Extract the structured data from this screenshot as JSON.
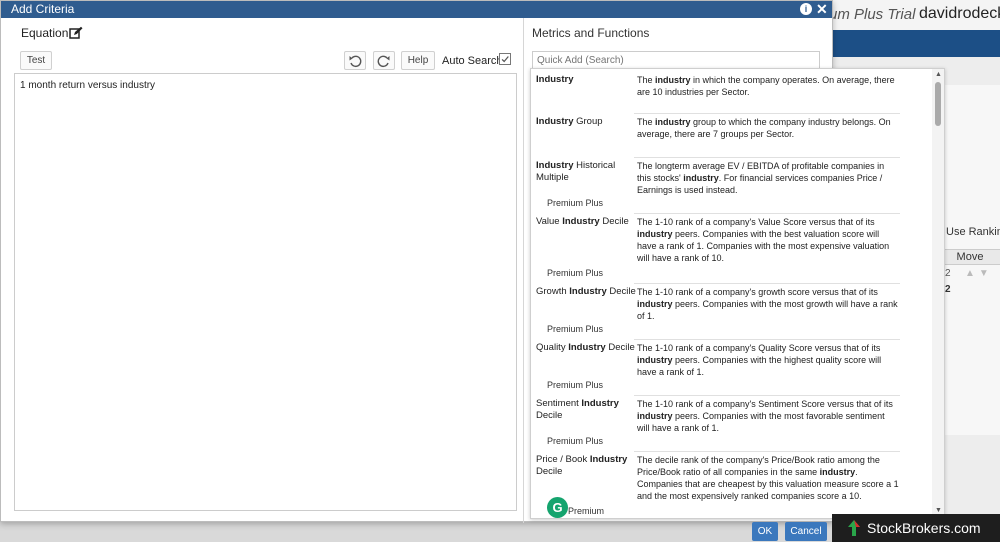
{
  "background": {
    "trial_text": "um Plus Trial",
    "username": "davidrodeck",
    "use_ranking": "Use Rankin",
    "move_header": "Move",
    "row1_num": "2",
    "row2_num": "2"
  },
  "dialog": {
    "title": "Add Criteria",
    "info_icon": "i",
    "close_icon": "✕"
  },
  "equation": {
    "header": "Equation",
    "test_label": "Test",
    "help_label": "Help",
    "auto_search_label": "Auto Search:",
    "text": "1 month return versus industry"
  },
  "metrics": {
    "header": "Metrics and Functions",
    "search_placeholder": "Quick Add (Search)",
    "premium_label": "Premium Plus",
    "truncated_premium": "Premium",
    "items": [
      {
        "name_pre": "",
        "name_bold": "Industry",
        "name_post": "",
        "desc_pre": "The ",
        "desc_bold": "industry",
        "desc_post": " in which the company operates. On average, there are 10 industries per Sector.",
        "premium": false
      },
      {
        "name_pre": "",
        "name_bold": "Industry",
        "name_post": " Group",
        "desc_pre": "The ",
        "desc_bold": "industry",
        "desc_post": " group to which the company industry belongs. On average, there are 7 groups per Sector.",
        "premium": false
      },
      {
        "name_pre": "",
        "name_bold": "Industry",
        "name_post": " Historical Multiple",
        "desc_pre": "The longterm average EV / EBITDA of profitable companies in this stocks' ",
        "desc_bold": "industry",
        "desc_post": ". For financial services companies Price / Earnings is used instead.",
        "premium": true
      },
      {
        "name_pre": "Value ",
        "name_bold": "Industry",
        "name_post": " Decile",
        "desc_pre": "The 1-10 rank of a company's Value Score versus that of its ",
        "desc_bold": "industry",
        "desc_post": " peers. Companies with the best valuation score will have a rank of 1. Companies with the most expensive valuation will have a rank of 10.",
        "premium": true
      },
      {
        "name_pre": "Growth ",
        "name_bold": "Industry",
        "name_post": " Decile",
        "desc_pre": "The 1-10 rank of a company's growth score versus that of its ",
        "desc_bold": "industry",
        "desc_post": " peers. Companies with the most growth will have a rank of 1.",
        "premium": true
      },
      {
        "name_pre": "Quality ",
        "name_bold": "Industry",
        "name_post": " Decile",
        "desc_pre": "The 1-10 rank of a company's Quality Score versus that of its ",
        "desc_bold": "industry",
        "desc_post": " peers. Companies with the highest quality score will have a rank of 1.",
        "premium": true
      },
      {
        "name_pre": "Sentiment ",
        "name_bold": "Industry",
        "name_post": " Decile",
        "desc_pre": "The 1-10 rank of a company's Sentiment Score versus that of its ",
        "desc_bold": "industry",
        "desc_post": " peers. Companies with the most favorable sentiment will have a rank of 1.",
        "premium": true
      },
      {
        "name_pre": "Price / Book ",
        "name_bold": "Industry",
        "name_post": " Decile",
        "desc_pre": "The decile rank of the company's Price/Book ratio among the Price/Book ratio of all companies in the same ",
        "desc_bold": "industry",
        "desc_post": ". Companies that are cheapest by this valuation measure score a 1 and the most expensively ranked companies score a 10.",
        "premium": false
      }
    ]
  },
  "footer": {
    "ok_label": "OK",
    "cancel_label": "Cancel"
  },
  "watermark": {
    "text": "StockBrokers.com"
  },
  "colors": {
    "title_bar": "#2f5c8f",
    "nav_bar": "#1c4f86",
    "primary_button": "#3b78bd",
    "grammarly": "#15a46e"
  }
}
